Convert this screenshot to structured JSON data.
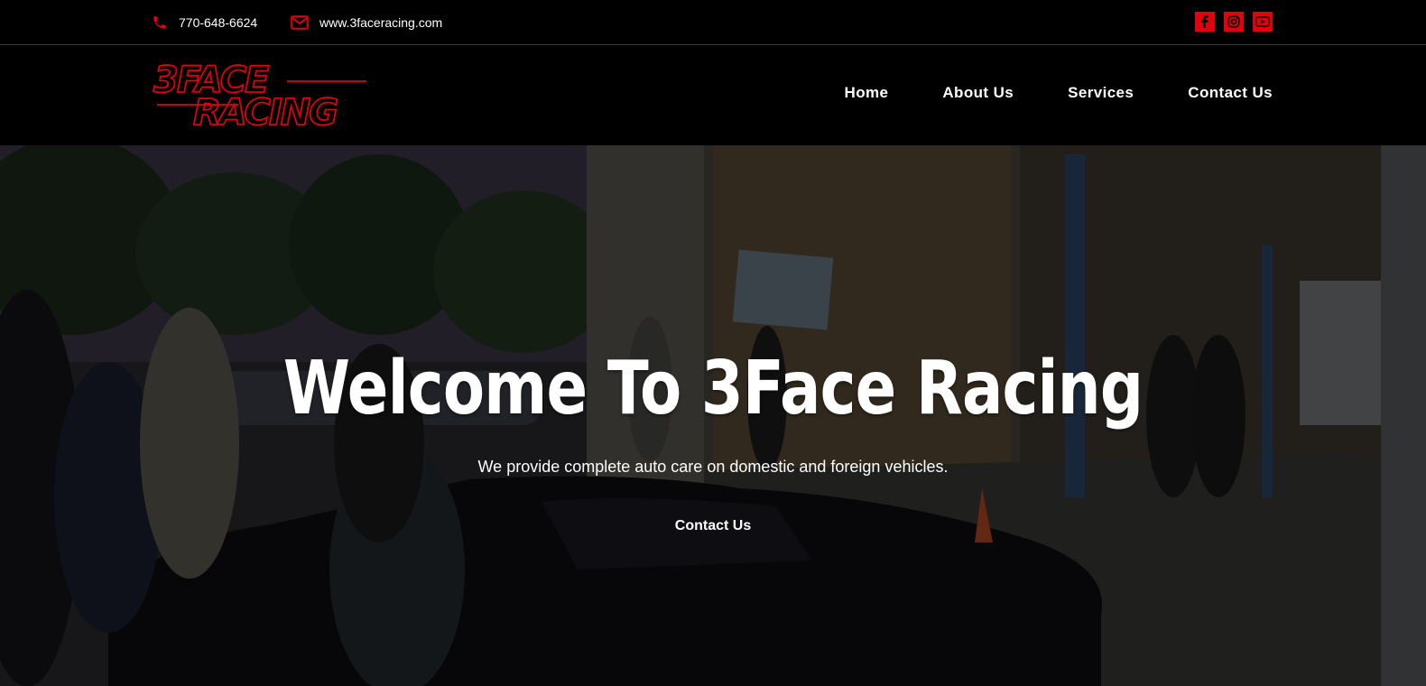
{
  "topbar": {
    "phone": "770-648-6624",
    "email": "www.3faceracing.com",
    "phone_icon": "phone-icon",
    "email_icon": "envelope-icon",
    "social": [
      "facebook-icon",
      "instagram-icon",
      "youtube-icon"
    ]
  },
  "logo": {
    "line1": "3FACE",
    "line2": "RACING"
  },
  "nav": {
    "items": [
      "Home",
      "About Us",
      "Services",
      "Contact Us"
    ]
  },
  "hero": {
    "title": "Welcome To 3Face Racing",
    "subtitle": "We provide complete auto care on domestic and foreign vehicles.",
    "cta": "Contact Us"
  },
  "colors": {
    "accent": "#e1000c",
    "background": "#000000",
    "text": "#ffffff"
  }
}
